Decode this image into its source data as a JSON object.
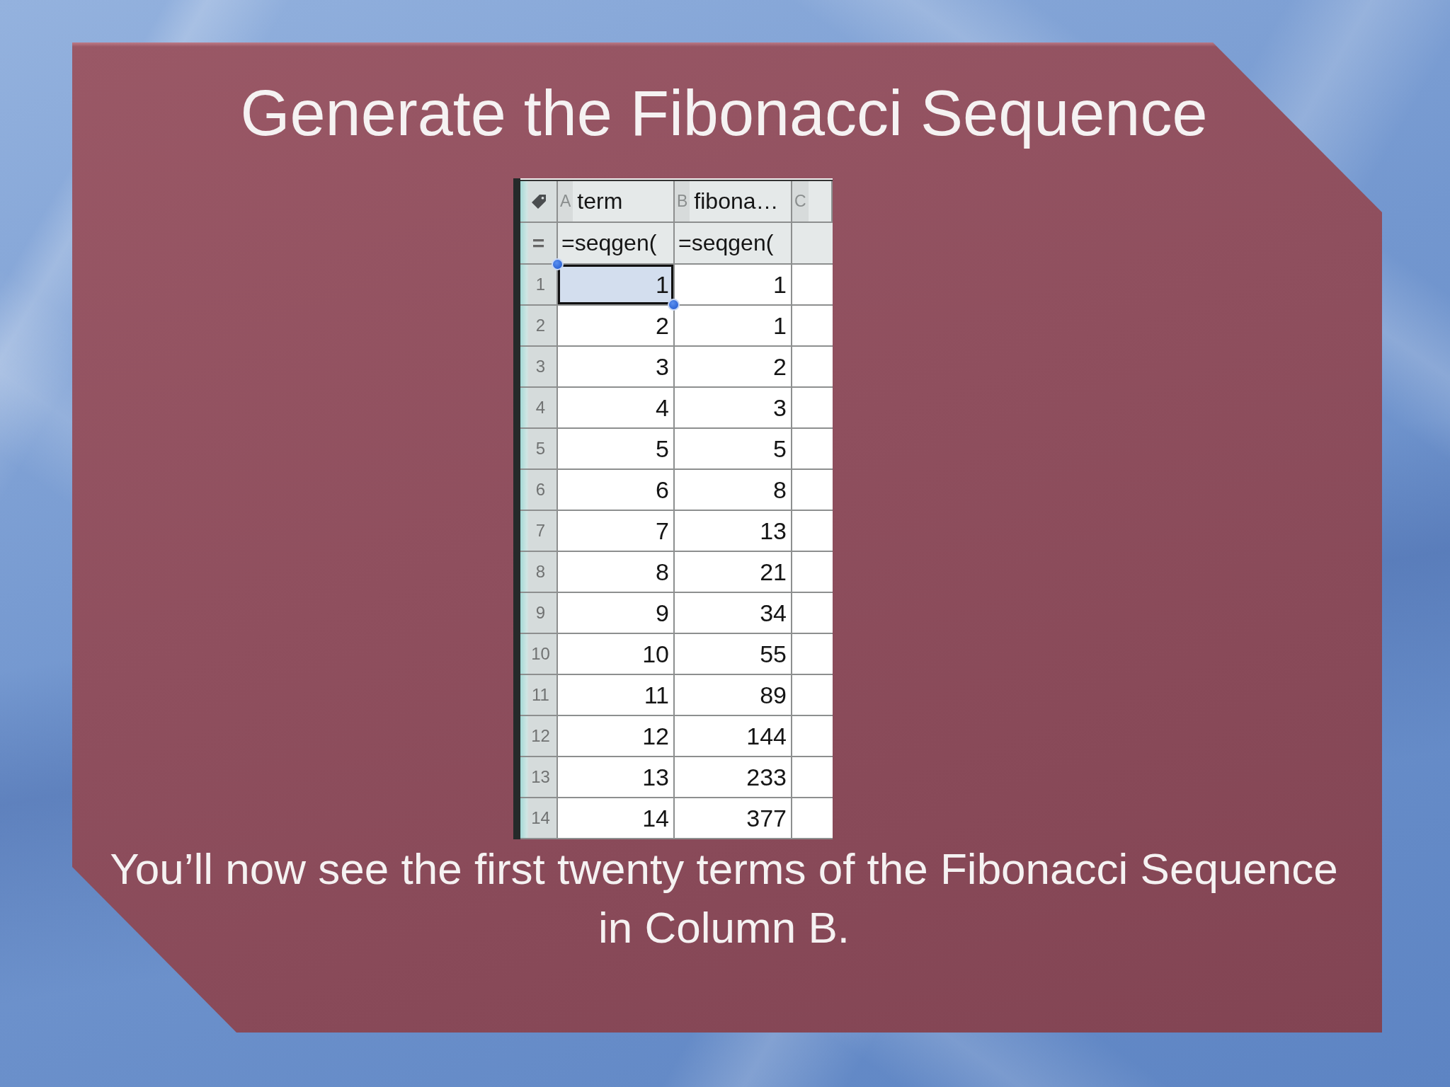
{
  "slide": {
    "title": "Generate the Fibonacci Sequence",
    "caption": "You’ll now see the first twenty terms of the Fibonacci Sequence in Column B."
  },
  "spreadsheet": {
    "formula_row_label": "=",
    "columns": [
      {
        "letter": "A",
        "name": "term",
        "formula": "=seqgen("
      },
      {
        "letter": "B",
        "name": "fibona…",
        "formula": "=seqgen("
      },
      {
        "letter": "C"
      }
    ],
    "rows": [
      {
        "number": "1",
        "cells": [
          {
            "value": "1",
            "selected": true
          },
          {
            "value": "1",
            "selected": false
          }
        ]
      },
      {
        "number": "2",
        "cells": [
          {
            "value": "2",
            "selected": false
          },
          {
            "value": "1",
            "selected": false
          }
        ]
      },
      {
        "number": "3",
        "cells": [
          {
            "value": "3",
            "selected": false
          },
          {
            "value": "2",
            "selected": false
          }
        ]
      },
      {
        "number": "4",
        "cells": [
          {
            "value": "4",
            "selected": false
          },
          {
            "value": "3",
            "selected": false
          }
        ]
      },
      {
        "number": "5",
        "cells": [
          {
            "value": "5",
            "selected": false
          },
          {
            "value": "5",
            "selected": false
          }
        ]
      },
      {
        "number": "6",
        "cells": [
          {
            "value": "6",
            "selected": false
          },
          {
            "value": "8",
            "selected": false
          }
        ]
      },
      {
        "number": "7",
        "cells": [
          {
            "value": "7",
            "selected": false
          },
          {
            "value": "13",
            "selected": false
          }
        ]
      },
      {
        "number": "8",
        "cells": [
          {
            "value": "8",
            "selected": false
          },
          {
            "value": "21",
            "selected": false
          }
        ]
      },
      {
        "number": "9",
        "cells": [
          {
            "value": "9",
            "selected": false
          },
          {
            "value": "34",
            "selected": false
          }
        ]
      },
      {
        "number": "10",
        "cells": [
          {
            "value": "10",
            "selected": false
          },
          {
            "value": "55",
            "selected": false
          }
        ]
      },
      {
        "number": "11",
        "cells": [
          {
            "value": "11",
            "selected": false
          },
          {
            "value": "89",
            "selected": false
          }
        ]
      },
      {
        "number": "12",
        "cells": [
          {
            "value": "12",
            "selected": false
          },
          {
            "value": "144",
            "selected": false
          }
        ]
      },
      {
        "number": "13",
        "cells": [
          {
            "value": "13",
            "selected": false
          },
          {
            "value": "233",
            "selected": false
          }
        ]
      },
      {
        "number": "14",
        "cells": [
          {
            "value": "14",
            "selected": false
          },
          {
            "value": "377",
            "selected": false
          }
        ]
      }
    ]
  }
}
